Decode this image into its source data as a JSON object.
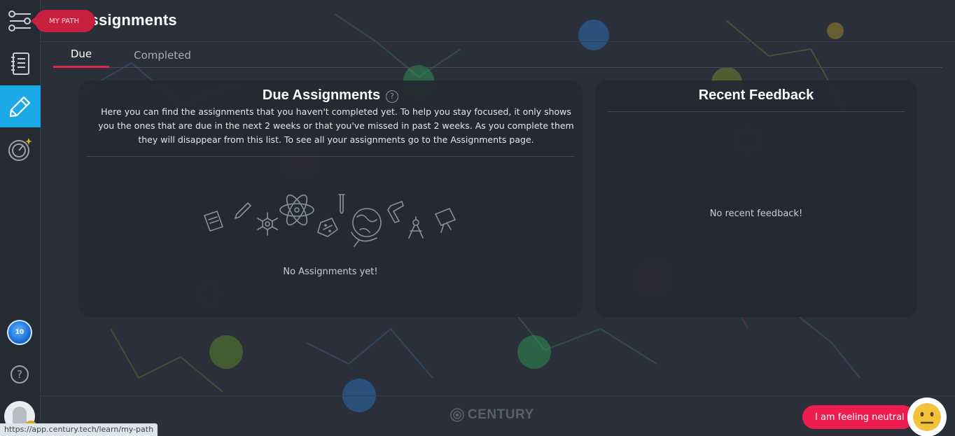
{
  "header": {
    "title": "My Assignments"
  },
  "sidebar": {
    "tooltip": "MY PATH",
    "items": [
      {
        "name": "my-path",
        "icon": "path-sliders-icon",
        "active": false
      },
      {
        "name": "courses",
        "icon": "notebook-icon",
        "active": false
      },
      {
        "name": "assignments",
        "icon": "pencil-icon",
        "active": true
      },
      {
        "name": "dashboard",
        "icon": "speedometer-icon",
        "active": false
      }
    ],
    "level": "10",
    "help": "?"
  },
  "tabs": [
    {
      "label": "Due",
      "active": true
    },
    {
      "label": "Completed",
      "active": false
    }
  ],
  "due_card": {
    "title": "Due Assignments",
    "info": "?",
    "description": "Here you can find the assignments that you haven't completed yet. To help you stay focused, it only shows you the ones that are due in the next 2 weeks or that you've missed in past 2 weeks. As you complete them they will disappear from this list. To see all your assignments go to the Assignments page.",
    "empty_message": "No Assignments yet!"
  },
  "feedback_card": {
    "title": "Recent Feedback",
    "empty_message": "No recent feedback!"
  },
  "footer": {
    "brand": "CENTURY"
  },
  "mood": {
    "label": "I am feeling neutral",
    "icon": "neutral-face-icon"
  },
  "status_bar": {
    "url": "https://app.century.tech/learn/my-path"
  },
  "colors": {
    "accent_blue": "#1ba9e8",
    "accent_red": "#e0284a",
    "mood_pink": "#ee1d4f",
    "background": "#2a2f3a"
  }
}
